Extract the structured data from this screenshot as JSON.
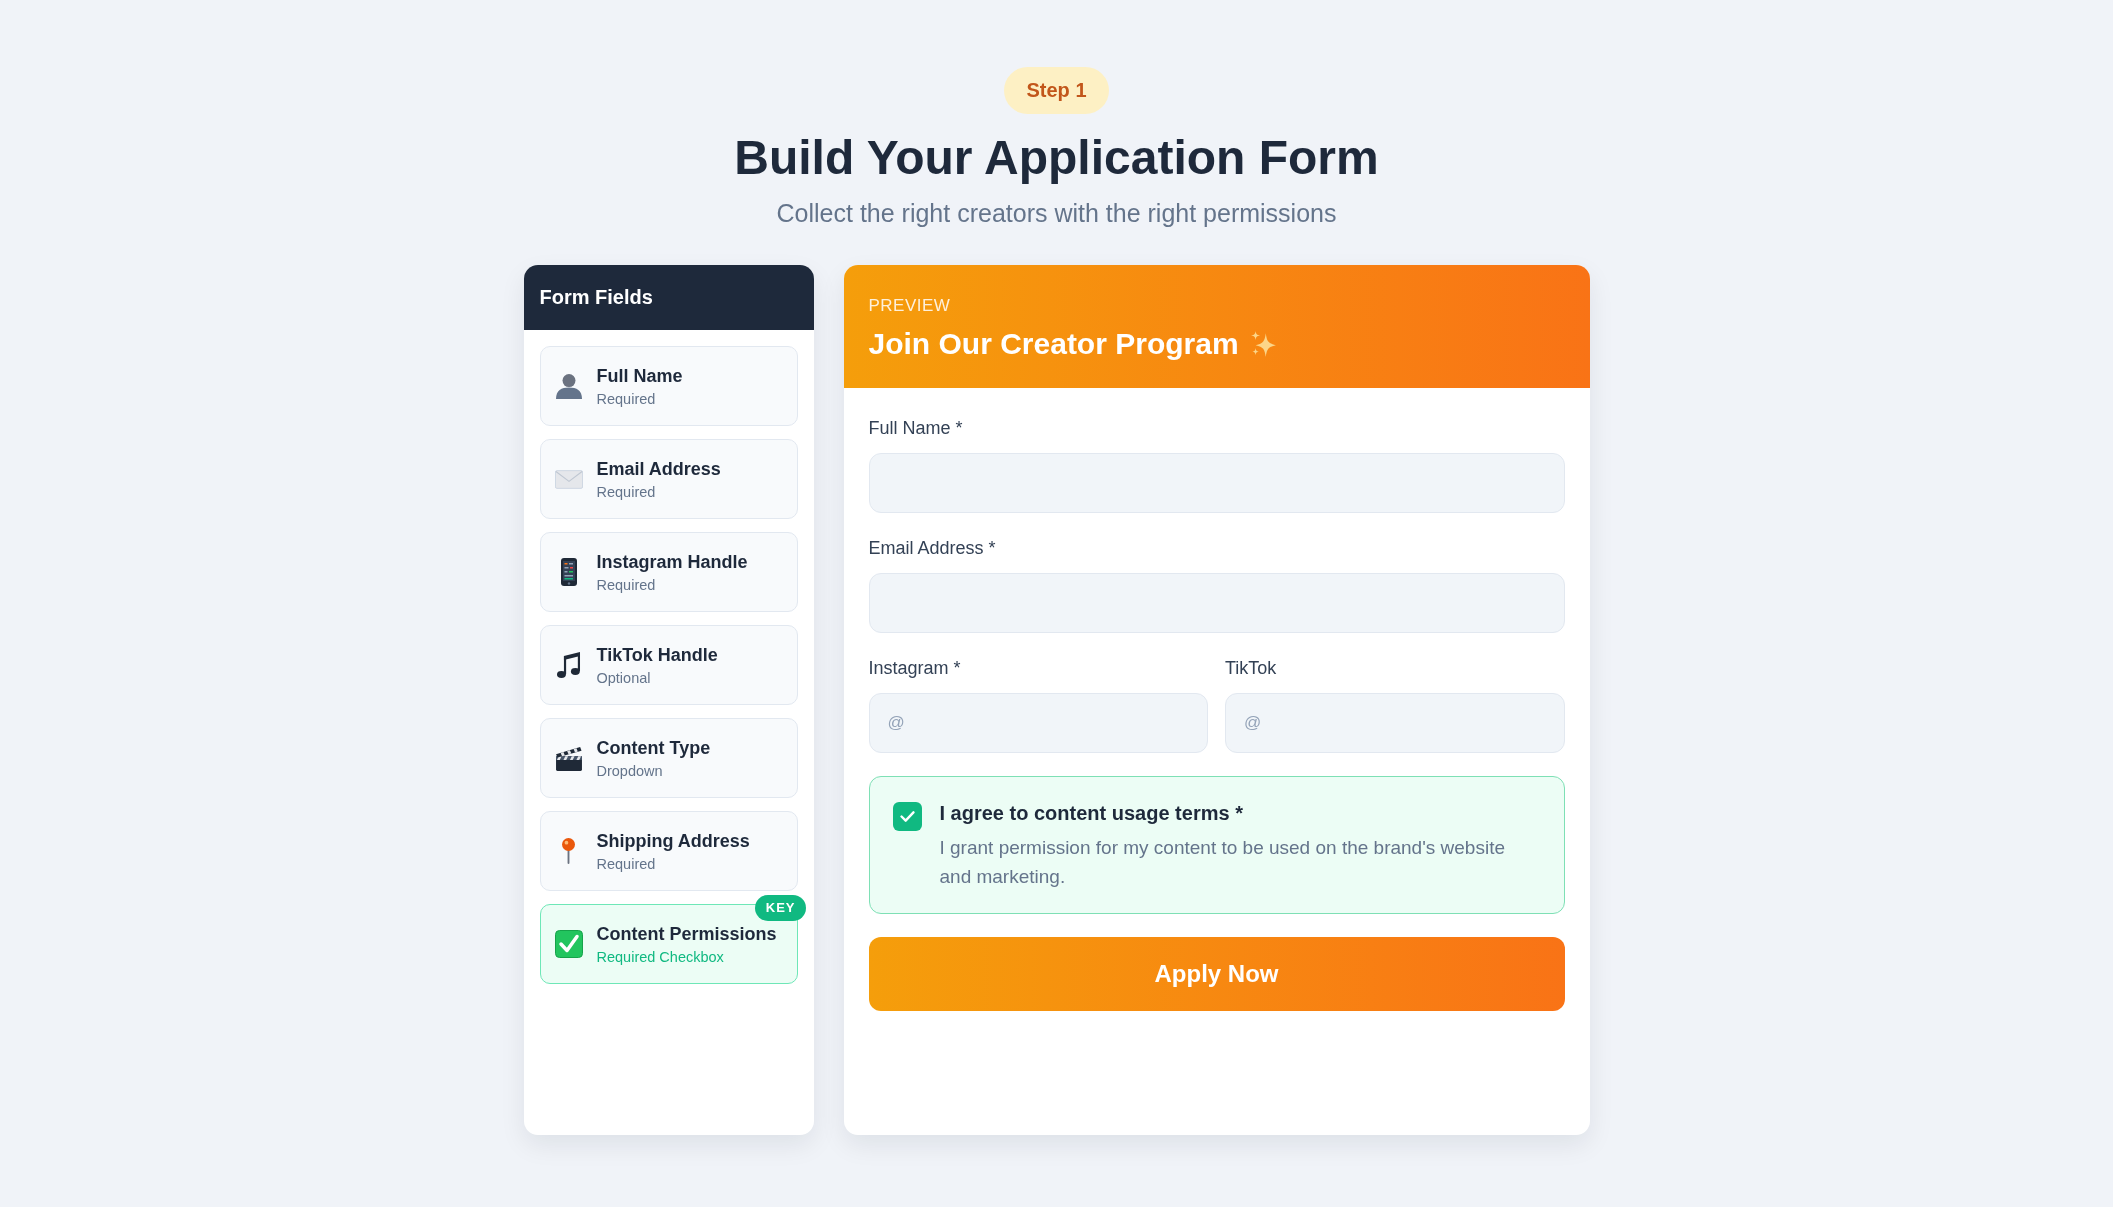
{
  "step_badge": "Step 1",
  "title": "Build Your Application Form",
  "subtitle": "Collect the right creators with the right permissions",
  "sidebar": {
    "title": "Form Fields",
    "items": [
      {
        "label": "Full Name",
        "note": "Required",
        "selected": false
      },
      {
        "label": "Email Address",
        "note": "Required",
        "selected": false
      },
      {
        "label": "Instagram Handle",
        "note": "Required",
        "selected": false
      },
      {
        "label": "TikTok Handle",
        "note": "Optional",
        "selected": false
      },
      {
        "label": "Content Type",
        "note": "Dropdown",
        "selected": false
      },
      {
        "label": "Shipping Address",
        "note": "Required",
        "selected": false
      },
      {
        "label": "Content Permissions",
        "note": "Required Checkbox",
        "selected": true,
        "badge": "KEY"
      }
    ]
  },
  "preview": {
    "label": "PREVIEW",
    "title": "Join Our Creator Program",
    "rows": [
      {
        "fields": [
          {
            "label": "Full Name *"
          }
        ]
      },
      {
        "fields": [
          {
            "label": "Email Address *"
          }
        ]
      },
      {
        "fields": [
          {
            "label": "Instagram *",
            "placeholder": "@"
          },
          {
            "label": "TikTok",
            "placeholder": "@"
          }
        ]
      }
    ],
    "consent": {
      "checked": true,
      "title": "I agree to content usage terms *",
      "description": "I grant permission for my content to be used on the brand's website and marketing."
    },
    "button": "Apply Now"
  }
}
